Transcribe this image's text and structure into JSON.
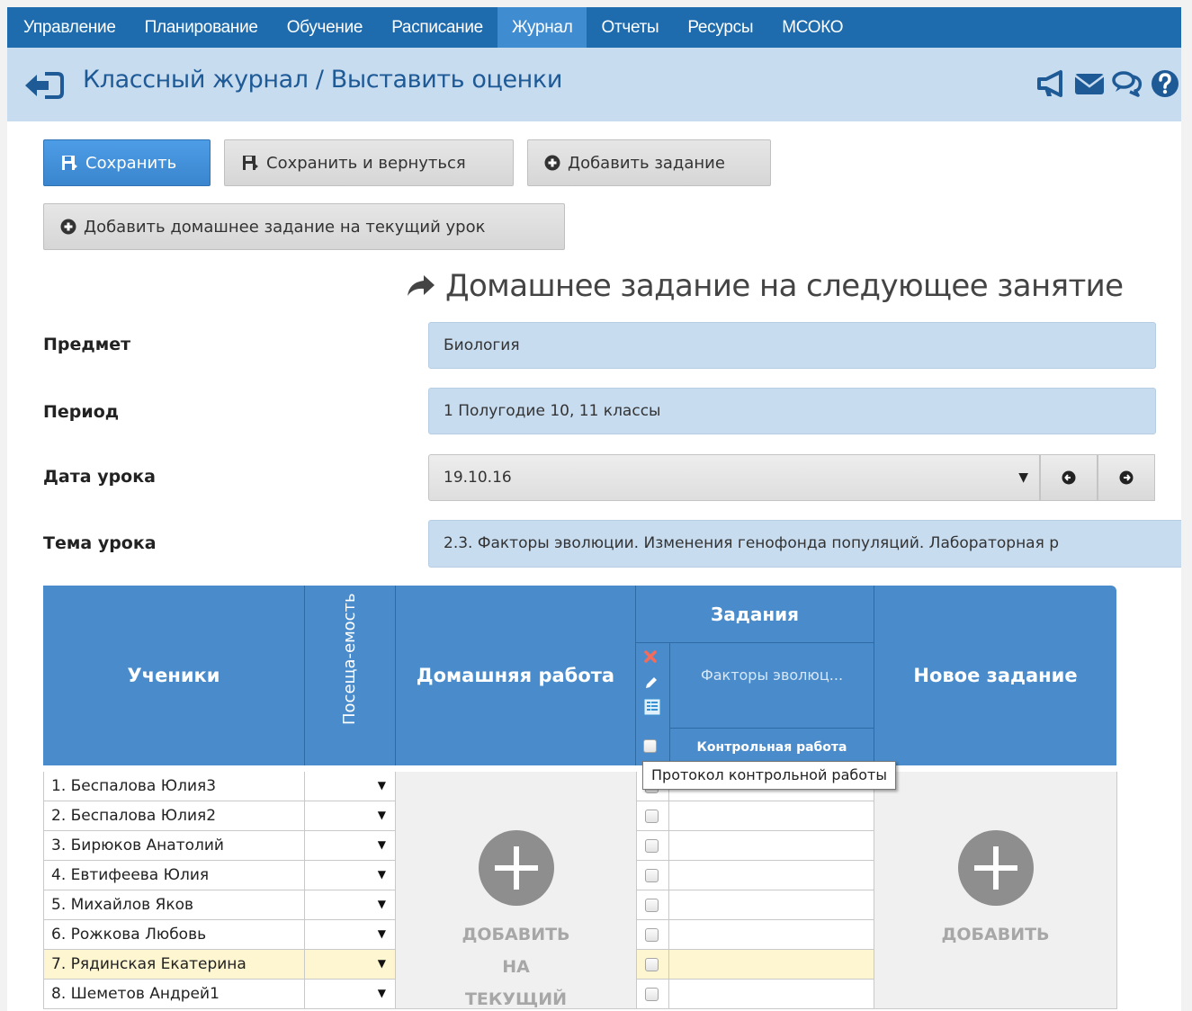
{
  "nav": {
    "items": [
      "Управление",
      "Планирование",
      "Обучение",
      "Расписание",
      "Журнал",
      "Отчеты",
      "Ресурсы",
      "МСОКО"
    ],
    "active": "Журнал"
  },
  "header": {
    "title": "Классный журнал / Выставить оценки",
    "icons": [
      "megaphone-icon",
      "envelope-icon",
      "chat-icon",
      "help-icon"
    ]
  },
  "toolbar": {
    "save_label": "Сохранить",
    "save_return_label": "Сохранить и вернуться",
    "add_task_label": "Добавить задание",
    "add_homework_current_label": "Добавить домашнее задание на текущий урок"
  },
  "homework": {
    "heading": "Домашнее задание на следующее занятие"
  },
  "form": {
    "subject_label": "Предмет",
    "subject_value": "Биология",
    "period_label": "Период",
    "period_value": "1 Полугодие 10, 11 классы",
    "date_label": "Дата урока",
    "date_value": "19.10.16",
    "topic_label": "Тема урока",
    "topic_value": "2.3. Факторы эволюции. Изменения генофонда популяций. Лабораторная р"
  },
  "table": {
    "col_students": "Ученики",
    "col_attendance": "Посеща-емость",
    "col_homework": "Домашняя работа",
    "col_tasks": "Задания",
    "task_name": "Факторы эволюц...",
    "task_type": "Контрольная работа",
    "col_new_task": "Новое задание",
    "students": [
      "1. Беспалова Юлия3",
      "2. Беспалова Юлия2",
      "3. Бирюков Анатолий",
      "4. Евтифеева Юлия",
      "5. Михайлов Яков",
      "6. Рожкова Любовь",
      "7. Рядинская Екатерина",
      "8. Шеметов Андрей1"
    ],
    "highlighted_row": 7,
    "homework_add_lines": [
      "ДОБАВИТЬ",
      "НА",
      "ТЕКУЩИЙ"
    ],
    "new_task_add": "ДОБАВИТЬ"
  },
  "tooltip": {
    "text": "Протокол контрольной работы"
  },
  "colors": {
    "nav_bg": "#1e6cad",
    "nav_active": "#3f8cd0",
    "title_bar": "#c8dcf0",
    "table_header": "#4a8ccb",
    "highlight_row": "#fdf6d0"
  }
}
